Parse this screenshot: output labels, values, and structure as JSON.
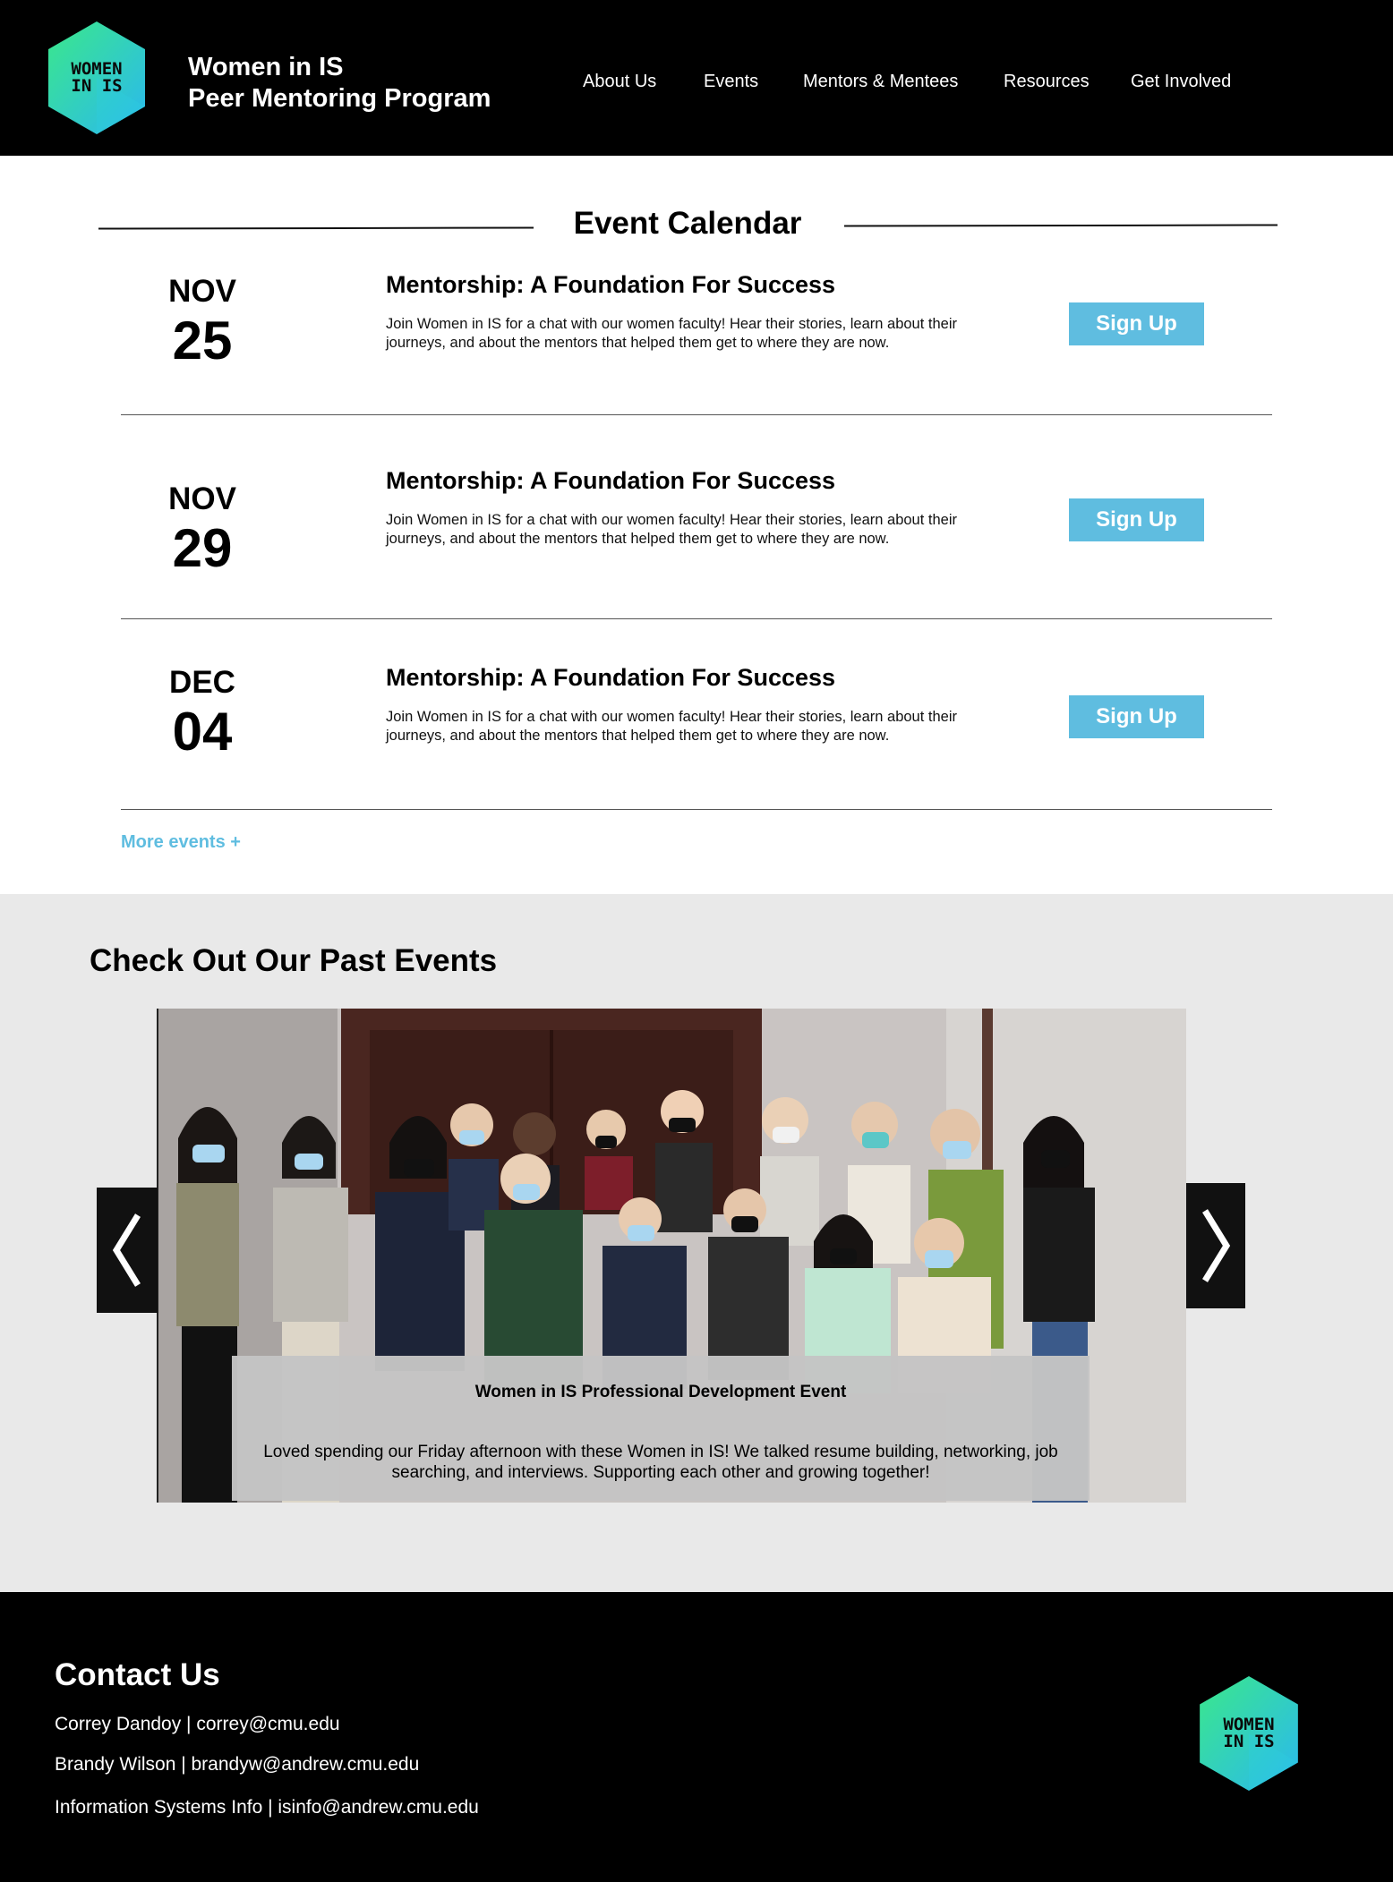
{
  "header": {
    "logo_line1": "WOMEN",
    "logo_line2": "IN IS",
    "title_line1": "Women in IS",
    "title_line2": "Peer Mentoring Program",
    "nav": [
      "About Us",
      "Events",
      "Mentors & Mentees",
      "Resources",
      "Get Involved"
    ]
  },
  "calendar": {
    "title": "Event Calendar",
    "events": [
      {
        "month": "NOV",
        "day": "25",
        "title": "Mentorship: A Foundation For Success",
        "desc": "Join Women in IS for a chat with our women faculty! Hear their stories, learn about their journeys, and about the mentors that helped them get to where they are now.",
        "button": "Sign Up"
      },
      {
        "month": "NOV",
        "day": "29",
        "title": "Mentorship: A Foundation For Success",
        "desc": "Join Women in IS for a chat with our women faculty! Hear their stories, learn about their journeys, and about the mentors that helped them get to where they are now.",
        "button": "Sign Up"
      },
      {
        "month": "DEC",
        "day": "04",
        "title": "Mentorship: A Foundation For Success",
        "desc": "Join Women in IS for a chat with our women faculty! Hear their stories, learn about their journeys, and about the mentors that helped them get to where they are now.",
        "button": "Sign Up"
      }
    ],
    "more_link": "More events +"
  },
  "past_events": {
    "title": "Check Out Our Past Events",
    "slide": {
      "caption_title": "Women in IS Professional Development Event",
      "caption_text": "Loved spending our Friday afternoon with these Women in IS! We talked resume building, networking, job searching, and interviews. Supporting each other and growing together!"
    },
    "prev_icon": "chevron-left-icon",
    "next_icon": "chevron-right-icon"
  },
  "footer": {
    "contact_title": "Contact Us",
    "contacts": [
      "Correy Dandoy | correy@cmu.edu",
      "Brandy Wilson | brandyw@andrew.cmu.edu",
      "Information Systems Info | isinfo@andrew.cmu.edu"
    ]
  },
  "colors": {
    "accent": "#5fbde0",
    "logo_gradient_start": "#3be88a",
    "logo_gradient_end": "#2ab8f0",
    "header_bg": "#000000",
    "past_bg": "#e9e9e9"
  }
}
